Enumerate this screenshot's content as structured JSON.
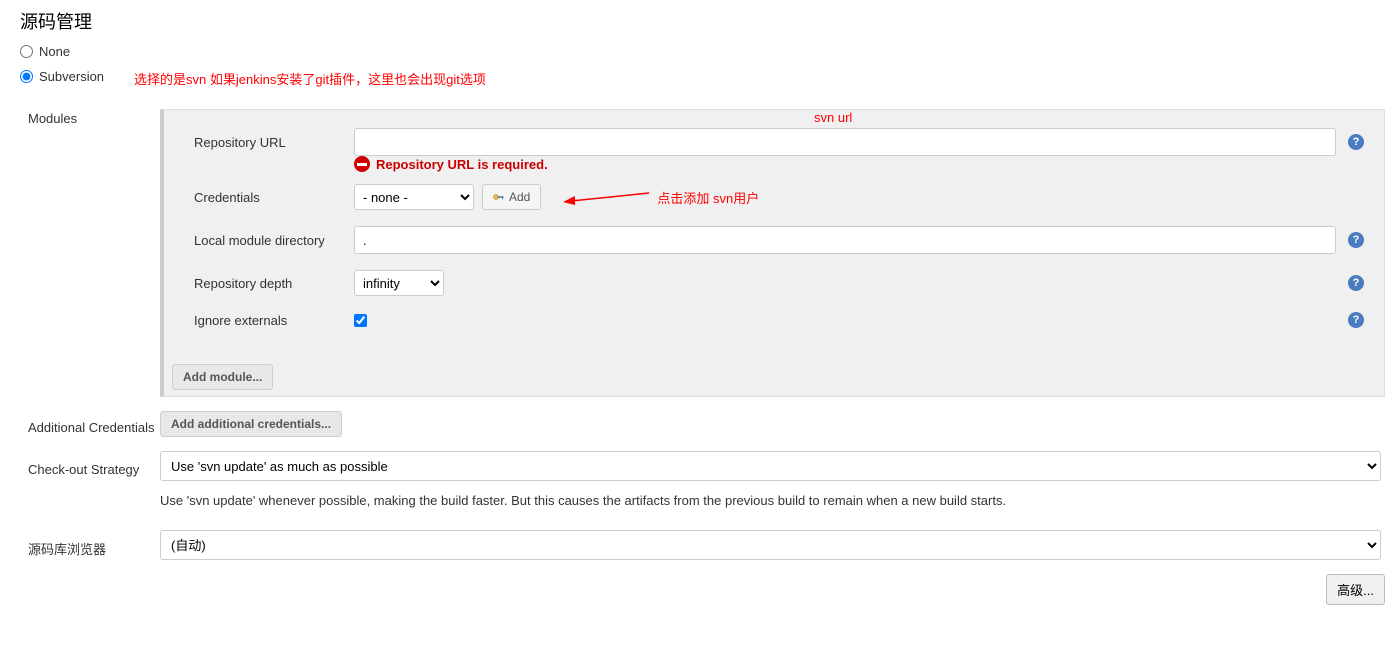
{
  "section_title": "源码管理",
  "scm": {
    "none_label": "None",
    "subversion_label": "Subversion",
    "annotation_top": "选择的是svn 如果jenkins安装了git插件，这里也会出现git选项"
  },
  "modules_label": "Modules",
  "module": {
    "repo_url_label": "Repository URL",
    "repo_url_value": "",
    "repo_url_annotation": "svn url",
    "repo_url_error": "Repository URL is required.",
    "credentials_label": "Credentials",
    "credentials_selected": "- none -",
    "credentials_add": "Add",
    "credentials_annotation": "点击添加 svn用户",
    "local_dir_label": "Local module directory",
    "local_dir_value": ".",
    "repo_depth_label": "Repository depth",
    "repo_depth_selected": "infinity",
    "ignore_ext_label": "Ignore externals",
    "ignore_ext_checked": true,
    "add_module_btn": "Add module..."
  },
  "additional_credentials": {
    "label": "Additional Credentials",
    "button": "Add additional credentials..."
  },
  "checkout_strategy": {
    "label": "Check-out Strategy",
    "selected": "Use 'svn update' as much as possible",
    "description": "Use 'svn update' whenever possible, making the build faster. But this causes the artifacts from the previous build to remain when a new build starts."
  },
  "repo_browser": {
    "label": "源码库浏览器",
    "selected": "(自动)"
  },
  "advanced_btn": "高级...",
  "help_symbol": "?"
}
